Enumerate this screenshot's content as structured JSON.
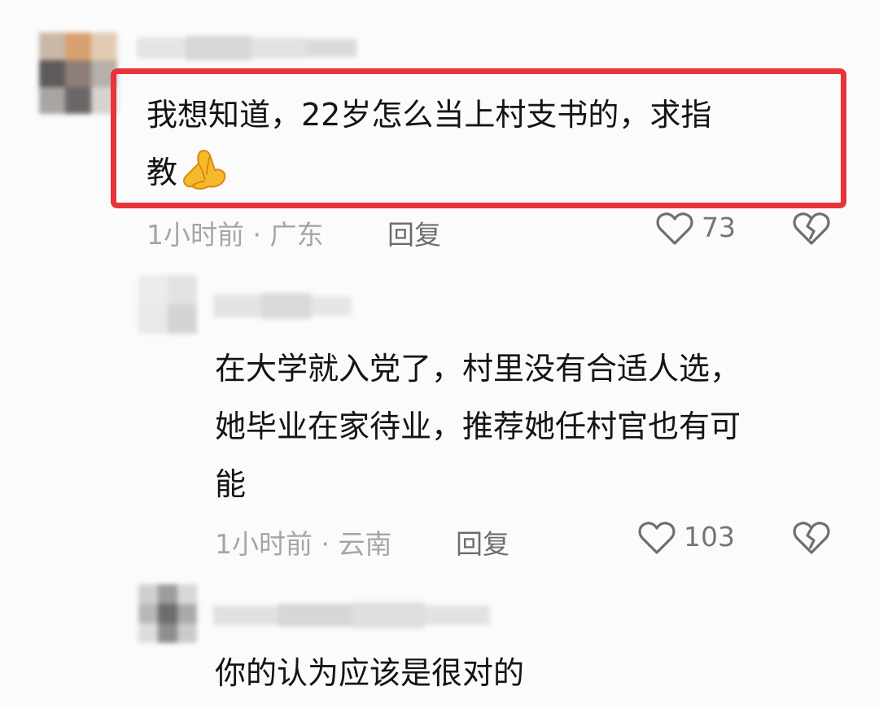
{
  "colors": {
    "highlight": "#e8343a",
    "text": "#141414",
    "meta": "#a6a6a6",
    "reply": "#6d6d6d",
    "emoji": "#f6b92b"
  },
  "comments": [
    {
      "lines": [
        "我想知道，22岁怎么当上村支书的，求指",
        "教"
      ],
      "emoji_icon": "pinched-fingers-emoji-icon",
      "time_location": "1小时前 · 广东",
      "reply_label": "回复",
      "likes": "73"
    },
    {
      "lines": [
        "在大学就入党了，村里没有合适人选，",
        "她毕业在家待业，推荐她任村官也有可",
        "能"
      ],
      "time_location": "1小时前 · 云南",
      "reply_label": "回复",
      "likes": "103"
    },
    {
      "lines": [
        "你的认为应该是很对的"
      ]
    }
  ]
}
